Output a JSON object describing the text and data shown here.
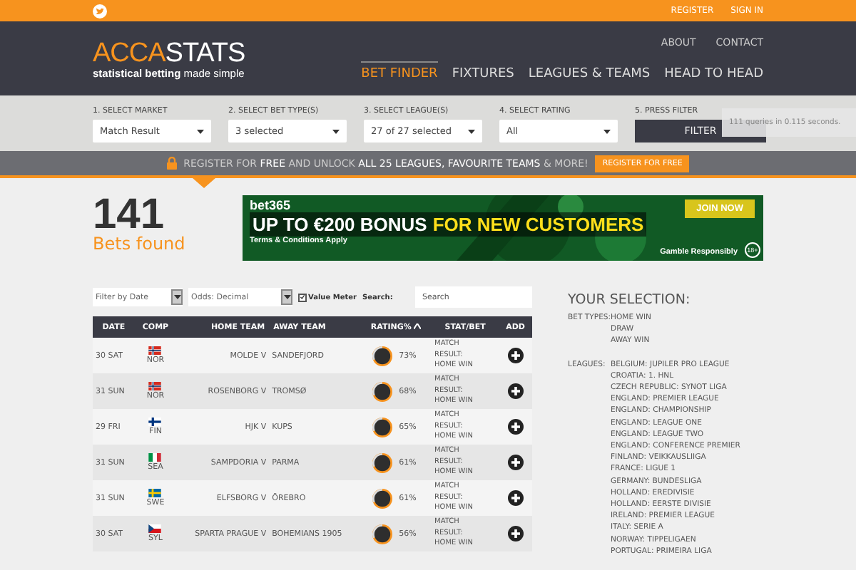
{
  "top_bar": {
    "links": [
      "REGISTER",
      "SIGN IN"
    ]
  },
  "header": {
    "logo_accent": "ACCA",
    "logo_rest": "STATS",
    "tagline_bold": "statistical betting",
    "tagline_rest": "made simple",
    "secondary_nav": [
      "ABOUT",
      "CONTACT"
    ],
    "nav": [
      {
        "label": "BET FINDER",
        "selected": true
      },
      {
        "label": "FIXTURES",
        "selected": false
      },
      {
        "label": "LEAGUES & TEAMS",
        "selected": false
      },
      {
        "label": "HEAD TO HEAD",
        "selected": false
      }
    ]
  },
  "filters": [
    {
      "label": "1. SELECT MARKET",
      "value": "Match Result"
    },
    {
      "label": "2. SELECT BET TYPE(S)",
      "value": "3 selected"
    },
    {
      "label": "3. SELECT LEAGUE(S)",
      "value": "27 of 27 selected"
    },
    {
      "label": "4. SELECT RATING",
      "value": "All"
    }
  ],
  "filter_action": {
    "label": "5. PRESS FILTER",
    "button": "FILTER"
  },
  "query_note": "111 queries in 0.115 seconds.",
  "promo": {
    "text": "REGISTER FOR **FREE** AND UNLOCK **ALL 25 LEAGUES, FAVOURITE TEAMS** & MORE!",
    "button": "REGISTER FOR FREE"
  },
  "results": {
    "count": "141",
    "label": "Bets found"
  },
  "ad": {
    "brand": "bet365",
    "headline": "UP TO €200 BONUS",
    "highlight": "FOR NEW CUSTOMERS",
    "button": "JOIN NOW",
    "terms": "Terms & Conditions Apply",
    "responsible": "Gamble Responsibly",
    "age": "18+"
  },
  "table_controls": {
    "date_filter": "Filter by Date",
    "odds": "Odds: Decimal",
    "value_meter": {
      "label": "Value Meter",
      "checked": true
    },
    "search_label": "Search:",
    "search_placeholder": "Search"
  },
  "table": {
    "columns": [
      "DATE",
      "COMP",
      "HOME TEAM",
      "AWAY TEAM",
      "RATING%",
      "STAT/BET",
      "ADD"
    ],
    "rows": [
      {
        "date": "30 SAT",
        "kind": "no",
        "comp": "NOR",
        "home": "MOLDE",
        "vs": "V",
        "away": "SANDEFJORD",
        "rating": "73%",
        "stat": "MATCH RESULT: HOME WIN"
      },
      {
        "date": "31 SUN",
        "kind": "no",
        "comp": "NOR",
        "home": "ROSENBORG",
        "vs": "V",
        "away": "TROMSØ",
        "rating": "68%",
        "stat": "MATCH RESULT: HOME WIN"
      },
      {
        "date": "29 FRI",
        "kind": "fi",
        "comp": "FIN",
        "home": "HJK",
        "vs": "V",
        "away": "KUPS",
        "rating": "65%",
        "stat": "MATCH RESULT: HOME WIN"
      },
      {
        "date": "31 SUN",
        "kind": "it",
        "comp": "SEA",
        "home": "SAMPDORIA",
        "vs": "V",
        "away": "PARMA",
        "rating": "61%",
        "stat": "MATCH RESULT: HOME WIN"
      },
      {
        "date": "31 SUN",
        "kind": "se",
        "comp": "SWE",
        "home": "ELFSBORG",
        "vs": "V",
        "away": "ÖREBRO",
        "rating": "61%",
        "stat": "MATCH RESULT: HOME WIN"
      },
      {
        "date": "30 SAT",
        "kind": "cz",
        "comp": "SYL",
        "home": "SPARTA PRAGUE",
        "vs": "V",
        "away": "BOHEMIANS 1905",
        "rating": "56%",
        "stat": "MATCH RESULT: HOME WIN"
      }
    ]
  },
  "selection": {
    "title": "YOUR SELECTION:",
    "groups": [
      {
        "label": "BET TYPES:",
        "items": [
          "HOME WIN",
          "DRAW",
          "AWAY WIN"
        ]
      },
      {
        "label": "LEAGUES:",
        "items": [
          "BELGIUM: JUPILER PRO LEAGUE",
          "CROATIA: 1. HNL",
          "CZECH REPUBLIC: SYNOT LIGA",
          "ENGLAND: PREMIER LEAGUE",
          "ENGLAND: CHAMPIONSHIP",
          "ENGLAND: LEAGUE ONE",
          "ENGLAND: LEAGUE TWO",
          "ENGLAND: CONFERENCE PREMIER",
          "FINLAND: VEIKKAUSLIIGA",
          "FRANCE: LIGUE 1",
          "GERMANY: BUNDESLIGA",
          "HOLLAND: EREDIVISIE",
          "HOLLAND: EERSTE DIVISIE",
          "IRELAND: PREMIER LEAGUE",
          "ITALY: SERIE A",
          "NORWAY: TIPPELIGAEN",
          "PORTUGAL: PRIMEIRA LIGA"
        ]
      }
    ]
  }
}
